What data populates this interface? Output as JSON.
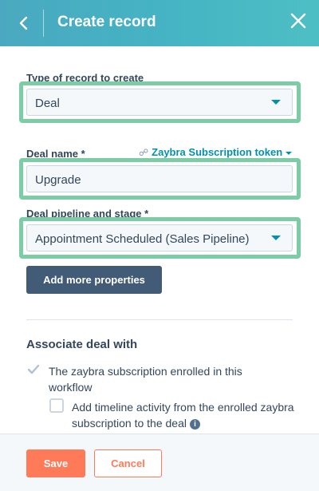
{
  "header": {
    "title": "Create record",
    "back_icon": "chevron-left-icon",
    "close_icon": "close-icon",
    "gradient": [
      "#4aa9c0",
      "#4dbfc4"
    ]
  },
  "record_type": {
    "label": "Type of record to create",
    "value": "Deal"
  },
  "deal_name": {
    "label": "Deal name *",
    "token_link": "Zaybra Subscription token",
    "token_icon": "personalization-token-icon",
    "value": "Upgrade"
  },
  "pipeline": {
    "label": "Deal pipeline and stage *",
    "value": "Appointment Scheduled (Sales Pipeline)"
  },
  "add_more_properties": "Add more properties",
  "associate": {
    "title": "Associate deal with",
    "option_enrolled": {
      "label": "The zaybra subscription enrolled in this workflow",
      "checked": true
    },
    "option_timeline": {
      "label": "Add timeline activity from the enrolled zaybra subscription to the deal",
      "checked": false,
      "info_icon": "info-icon"
    }
  },
  "footer": {
    "save_label": "Save",
    "cancel_label": "Cancel"
  },
  "colors": {
    "highlight": "#7ccda6",
    "primary": "#ff7a59",
    "secondary_button": "#425b76",
    "link": "#0091ae"
  }
}
